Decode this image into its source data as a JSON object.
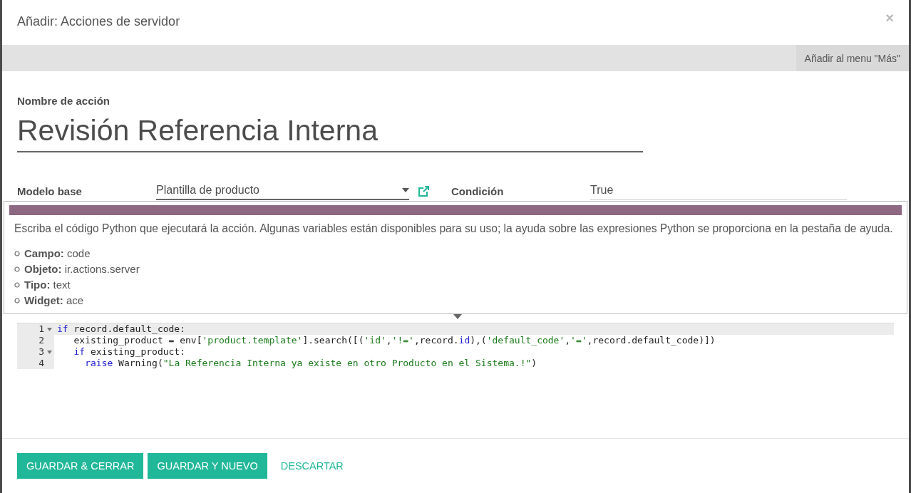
{
  "dialog": {
    "title": "Añadir: Acciones de servidor",
    "close": "×"
  },
  "toolbar": {
    "buttons": [
      "Añadir al menu \"Más\""
    ]
  },
  "form": {
    "name_label": "Nombre de acción",
    "name_value": "Revisión Referencia Interna",
    "fields": [
      {
        "kind": "select",
        "label": "Modelo base",
        "value": "Plantilla de producto",
        "external_link": true
      },
      {
        "kind": "text",
        "label": "Condición",
        "value": "True"
      }
    ]
  },
  "code": {
    "lines": [
      {
        "number": "1",
        "fold": true,
        "active": true,
        "tokens": [
          {
            "kind": "keyword",
            "text": "if"
          },
          {
            "kind": "plain",
            "text": " record.default_code:"
          }
        ]
      },
      {
        "number": "2",
        "fold": false,
        "active": false,
        "tokens": [
          {
            "kind": "plain",
            "text": "   existing_product = env["
          },
          {
            "kind": "string",
            "text": "'product.template'"
          },
          {
            "kind": "plain",
            "text": "].search([("
          },
          {
            "kind": "string",
            "text": "'id'"
          },
          {
            "kind": "plain",
            "text": ","
          },
          {
            "kind": "string",
            "text": "'!='"
          },
          {
            "kind": "plain",
            "text": ",record."
          },
          {
            "kind": "keyword",
            "text": "id"
          },
          {
            "kind": "plain",
            "text": "),("
          },
          {
            "kind": "string",
            "text": "'default_code'"
          },
          {
            "kind": "plain",
            "text": ","
          },
          {
            "kind": "string",
            "text": "'='"
          },
          {
            "kind": "plain",
            "text": ",record.default_code)])"
          }
        ]
      },
      {
        "number": "3",
        "fold": true,
        "active": false,
        "tokens": [
          {
            "kind": "keyword",
            "text": "   if"
          },
          {
            "kind": "plain",
            "text": " existing_product:"
          }
        ]
      },
      {
        "number": "4",
        "fold": false,
        "active": false,
        "tokens": [
          {
            "kind": "keyword",
            "text": "     raise"
          },
          {
            "kind": "plain",
            "text": " Warning("
          },
          {
            "kind": "string",
            "text": "\"La Referencia Interna ya existe en otro Producto en el Sistema.!\""
          },
          {
            "kind": "plain",
            "text": ")"
          }
        ]
      }
    ]
  },
  "tooltip": {
    "description": "Escriba el código Python que ejecutará la acción. Algunas variables están disponibles para su uso; la ayuda sobre las expresiones Python se proporciona en la pestaña de ayuda.",
    "items": [
      {
        "label": "Campo:",
        "value": "code"
      },
      {
        "label": "Objeto:",
        "value": "ir.actions.server"
      },
      {
        "label": "Tipo:",
        "value": "text"
      },
      {
        "label": "Widget:",
        "value": "ace"
      }
    ]
  },
  "footer": {
    "buttons": [
      {
        "kind": "primary",
        "label": "GUARDAR & CERRAR"
      },
      {
        "kind": "primary",
        "label": "GUARDAR Y NUEVO"
      },
      {
        "kind": "link",
        "label": "DESCARTAR"
      }
    ]
  }
}
